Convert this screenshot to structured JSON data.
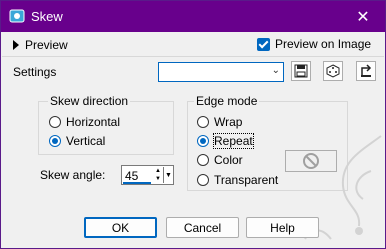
{
  "window": {
    "title": "Skew",
    "close_glyph": "✕"
  },
  "preview": {
    "label": "Preview"
  },
  "preview_on_image": {
    "label": "Preview on Image",
    "checked": true
  },
  "settings": {
    "label": "Settings",
    "value": ""
  },
  "skew_direction": {
    "title": "Skew direction",
    "options": [
      {
        "label": "Horizontal",
        "selected": false
      },
      {
        "label": "Vertical",
        "selected": true
      }
    ]
  },
  "edge_mode": {
    "title": "Edge mode",
    "options": [
      {
        "label": "Wrap",
        "selected": false
      },
      {
        "label": "Repeat",
        "selected": true
      },
      {
        "label": "Color",
        "selected": false
      },
      {
        "label": "Transparent",
        "selected": false
      }
    ]
  },
  "skew_angle": {
    "label": "Skew angle:",
    "value": "45"
  },
  "buttons": {
    "ok": "OK",
    "cancel": "Cancel",
    "help": "Help"
  },
  "colors": {
    "titlebar": "#68008c",
    "accent": "#0067c0"
  }
}
